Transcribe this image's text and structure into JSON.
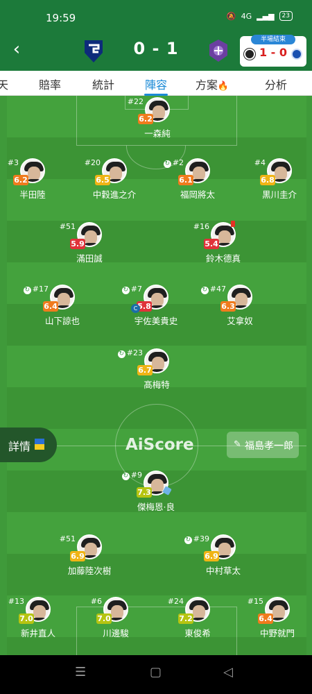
{
  "status_bar": {
    "time": "19:59",
    "signal": "4G",
    "battery": "23"
  },
  "header": {
    "back_icon": "chevron-left-icon",
    "home_logo": "gamba-osaka-crest-icon",
    "away_logo": "sanfrecce-hiroshima-crest-icon",
    "score": "0 - 1",
    "mini_match": {
      "tag": "半場結束",
      "score": "1 - 0",
      "home_badge": "newcastle-crest-icon",
      "away_badge": "chelsea-crest-icon"
    }
  },
  "tabs": [
    {
      "label": "天",
      "active": false
    },
    {
      "label": "賠率",
      "active": false
    },
    {
      "label": "統計",
      "active": false
    },
    {
      "label": "陣容",
      "active": true
    },
    {
      "label": "方案",
      "active": false,
      "badge_icon": "fire-icon"
    },
    {
      "label": "分析",
      "active": false
    }
  ],
  "colors": {
    "header_bg": "#1c7a3a",
    "tab_active": "#1b8ad6",
    "pitch": "#44a23d",
    "rating_orange": "#f07b1d",
    "rating_red": "#e0333a",
    "rating_yellow": "#f0b415",
    "rating_lime": "#b6c412"
  },
  "players": [
    {
      "number": "#22",
      "name": "一森純",
      "rating": "6.2",
      "rating_color": "orange",
      "substituted": false
    },
    {
      "number": "#3",
      "name": "半田陸",
      "rating": "6.2",
      "rating_color": "orange",
      "substituted": false
    },
    {
      "number": "#20",
      "name": "中穀進之介",
      "rating": "6.5",
      "rating_color": "yellow",
      "substituted": false
    },
    {
      "number": "#2",
      "name": "福岡將太",
      "rating": "6.1",
      "rating_color": "orange",
      "substituted": true
    },
    {
      "number": "#4",
      "name": "黒川圭介",
      "rating": "6.8",
      "rating_color": "yellow",
      "substituted": false
    },
    {
      "number": "#51",
      "name": "滿田誠",
      "rating": "5.9",
      "rating_color": "red",
      "substituted": false
    },
    {
      "number": "#16",
      "name": "鈴木德真",
      "rating": "5.4",
      "rating_color": "red",
      "substituted": false,
      "red_card": true
    },
    {
      "number": "#17",
      "name": "山下諒也",
      "rating": "6.4",
      "rating_color": "orange",
      "substituted": true
    },
    {
      "number": "#7",
      "name": "宇佐美貴史",
      "rating": "5.8",
      "rating_color": "red",
      "substituted": true,
      "captain": true
    },
    {
      "number": "#47",
      "name": "艾拿奴",
      "rating": "6.3",
      "rating_color": "orange",
      "substituted": true
    },
    {
      "number": "#23",
      "name": "髙梅特",
      "rating": "6.7",
      "rating_color": "yellow",
      "substituted": true
    },
    {
      "number": "#9",
      "name": "傑梅恩·良",
      "rating": "7.3",
      "rating_color": "lime",
      "substituted": true,
      "assist": true
    },
    {
      "number": "#51",
      "name": "加藤陸次樹",
      "rating": "6.9",
      "rating_color": "yellow",
      "substituted": false
    },
    {
      "number": "#39",
      "name": "中村草太",
      "rating": "6.9",
      "rating_color": "yellow",
      "substituted": true
    },
    {
      "number": "#13",
      "name": "新井直人",
      "rating": "7.0",
      "rating_color": "lime",
      "substituted": false
    },
    {
      "number": "#6",
      "name": "川邊駿",
      "rating": "7.0",
      "rating_color": "lime",
      "substituted": false
    },
    {
      "number": "#24",
      "name": "東俊希",
      "rating": "7.2",
      "rating_color": "lime",
      "substituted": false
    },
    {
      "number": "#15",
      "name": "中野就門",
      "rating": "6.4",
      "rating_color": "orange",
      "substituted": false
    }
  ],
  "watermark": "AiScore",
  "details_button": {
    "label": "詳情",
    "icon": "ukraine-flag-icon"
  },
  "referee": {
    "icon": "whistle-icon",
    "name": "福島孝一郎"
  },
  "nav_bar": {
    "menu_icon": "menu-icon",
    "home_icon": "square-home-icon",
    "back_icon": "triangle-back-icon"
  }
}
